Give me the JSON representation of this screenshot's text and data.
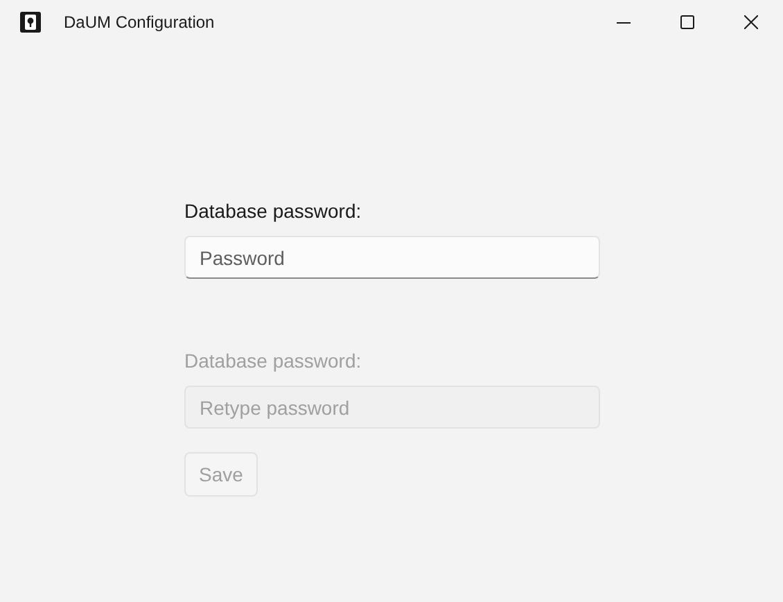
{
  "window": {
    "title": "DaUM Configuration"
  },
  "fields": [
    {
      "label": "Database password:",
      "placeholder": "Password",
      "disabled": false
    },
    {
      "label": "Database password:",
      "placeholder": "Retype password",
      "disabled": true
    }
  ],
  "save_button": {
    "label": "Save",
    "disabled": true
  }
}
